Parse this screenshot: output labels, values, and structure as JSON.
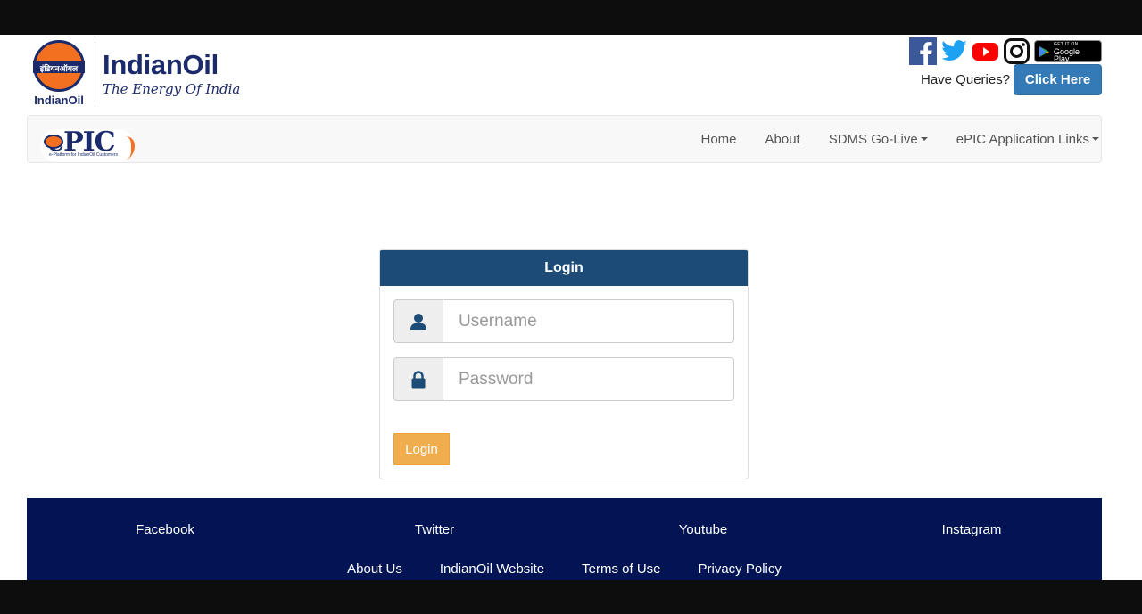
{
  "header": {
    "seal_text": "इंडियनऑयल",
    "seal_caption": "IndianOil",
    "brand_name": "IndianOil",
    "tagline": "The Energy Of India",
    "social_icons": [
      "facebook-icon",
      "twitter-icon",
      "youtube-icon",
      "instagram-icon",
      "google-play-badge"
    ],
    "google_play_small": "GET IT ON",
    "google_play_big": "Google Play",
    "queries_label": "Have Queries?",
    "click_here": "Click Here"
  },
  "navbar": {
    "logo_text": "ePIC",
    "logo_sub": "e-Platform for IndianOil Customers",
    "links": [
      "Home",
      "About",
      "SDMS Go-Live",
      "ePIC Application Links"
    ]
  },
  "login": {
    "title": "Login",
    "username_placeholder": "Username",
    "password_placeholder": "Password",
    "button": "Login"
  },
  "footer": {
    "social_links": [
      "Facebook",
      "Twitter",
      "Youtube",
      "Instagram"
    ],
    "links": [
      "About Us",
      "IndianOil Website",
      "Terms of Use",
      "Privacy Policy"
    ]
  },
  "colors": {
    "brand_navy": "#1b2a6b",
    "brand_orange": "#f37021",
    "panel_header": "#1b4b76",
    "login_button": "#f0ad4e",
    "click_here_button": "#337ab7",
    "footer_bg": "#021454"
  }
}
